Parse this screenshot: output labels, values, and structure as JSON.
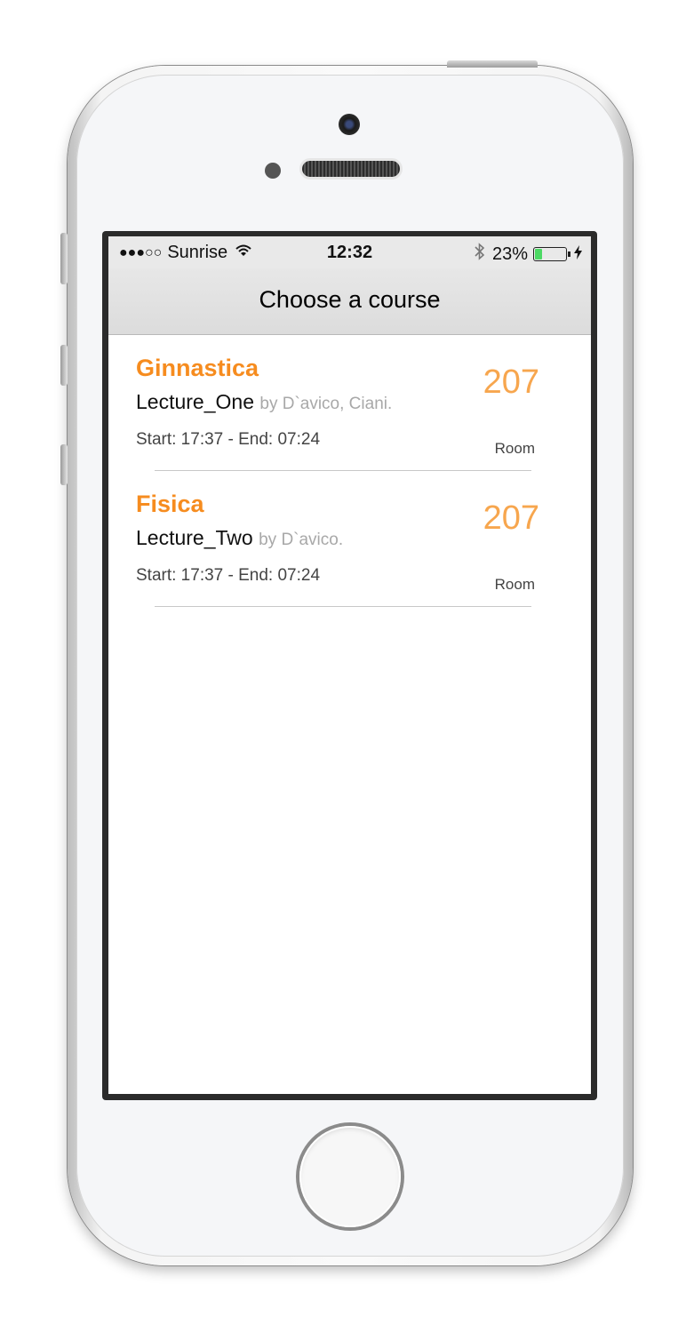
{
  "status_bar": {
    "signal": "●●●○○",
    "carrier": "Sunrise",
    "time": "12:32",
    "battery_percent": "23%",
    "battery_level": 0.23,
    "icons": [
      "wifi-icon",
      "bluetooth-icon",
      "battery-icon",
      "charging-icon"
    ]
  },
  "nav": {
    "title": "Choose a course"
  },
  "courses": [
    {
      "name": "Ginnastica",
      "lecture": "Lecture_One",
      "by": "by D`avico, Ciani.",
      "times": "Start: 17:37 - End: 07:24",
      "room": "207",
      "room_label": "Room"
    },
    {
      "name": "Fisica",
      "lecture": "Lecture_Two",
      "by": "by D`avico.",
      "times": "Start: 17:37 - End: 07:24",
      "room": "207",
      "room_label": "Room"
    }
  ],
  "colors": {
    "accent": "#f68c1f",
    "room_number": "#f7a64e",
    "navbar": "#e3e3e3"
  }
}
